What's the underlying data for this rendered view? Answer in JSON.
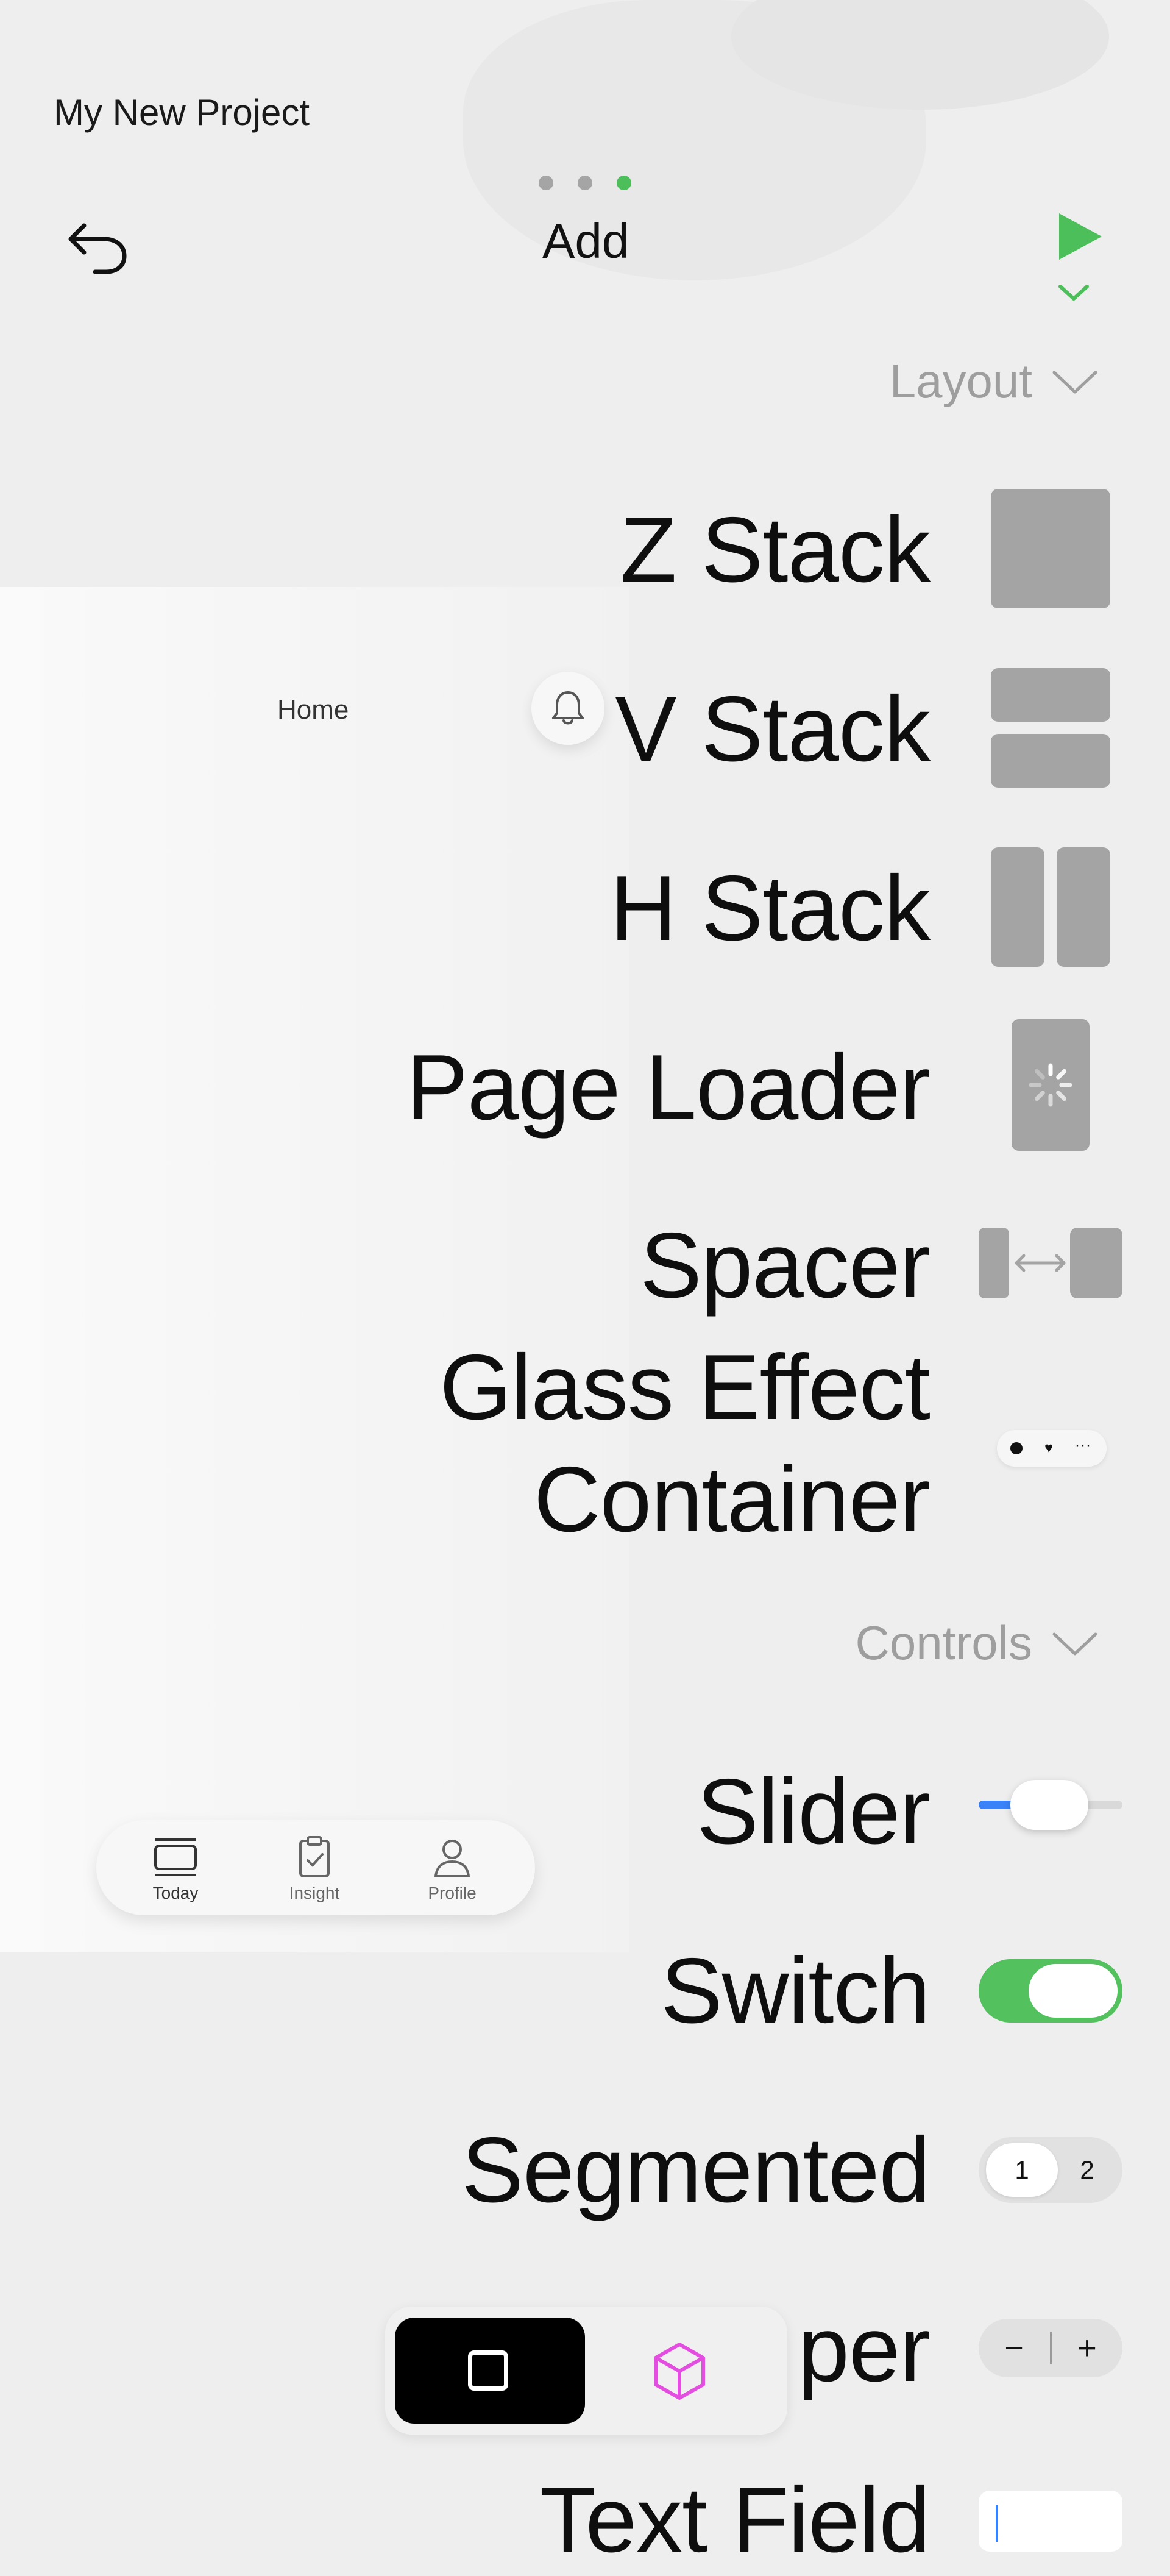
{
  "header": {
    "project_title": "My New Project",
    "title": "Add",
    "page_dots": 3,
    "active_dot_index": 2,
    "accent_color": "#4cbf5a"
  },
  "sections": {
    "layout": "Layout",
    "controls": "Controls"
  },
  "layout_items": {
    "z_stack": "Z Stack",
    "v_stack": "V Stack",
    "h_stack": "H Stack",
    "page_loader": "Page Loader",
    "spacer": "Spacer",
    "glass_line1": "Glass Effect",
    "glass_line2": "Container"
  },
  "control_items": {
    "slider": "Slider",
    "switch": "Switch",
    "segmented": "Segmented",
    "stepper_partial": "per",
    "text_field": "Text Field"
  },
  "segmented_preview": {
    "option1": "1",
    "option2": "2"
  },
  "stepper_preview": {
    "minus": "−",
    "plus": "+"
  },
  "preview": {
    "title": "Home",
    "tabs": [
      "Today",
      "Insight",
      "Profile"
    ],
    "active_tab_index": 0
  },
  "toolbar": {
    "selected_tool": "square-icon",
    "other_tool": "cube-icon",
    "cube_color": "#e34ee0"
  }
}
